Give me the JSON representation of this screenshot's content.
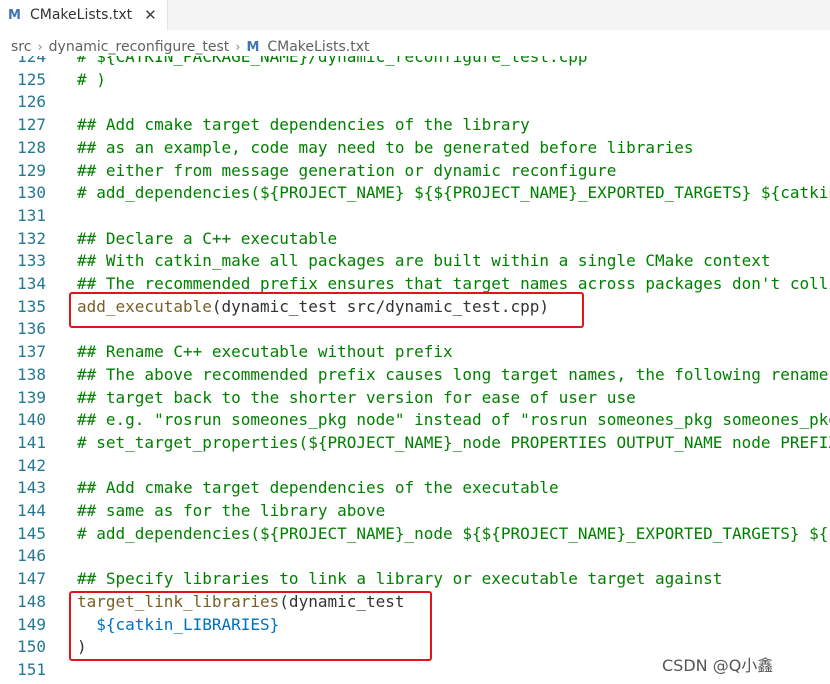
{
  "tab": {
    "icon": "cmake-file-icon",
    "label": "CMakeLists.txt",
    "close": "✕"
  },
  "breadcrumb": {
    "part1": "src",
    "part2": "dynamic_reconfigure_test",
    "file": "CMakeLists.txt"
  },
  "lines": [
    {
      "n": "124",
      "t": "# ${CATKIN_PACKAGE_NAME}/dynamic_reconfigure_test.cpp",
      "k": "cmt"
    },
    {
      "n": "125",
      "t": "# )",
      "k": "cmt"
    },
    {
      "n": "126",
      "t": "",
      "k": "cmt"
    },
    {
      "n": "127",
      "t": "## Add cmake target dependencies of the library",
      "k": "cmt"
    },
    {
      "n": "128",
      "t": "## as an example, code may need to be generated before libraries",
      "k": "cmt"
    },
    {
      "n": "129",
      "t": "## either from message generation or dynamic reconfigure",
      "k": "cmt"
    },
    {
      "n": "130",
      "t": "# add_dependencies(${PROJECT_NAME} ${${PROJECT_NAME}_EXPORTED_TARGETS} ${catkin_EXPORTED_TARGETS})",
      "k": "cmt"
    },
    {
      "n": "131",
      "t": "",
      "k": "cmt"
    },
    {
      "n": "132",
      "t": "## Declare a C++ executable",
      "k": "cmt"
    },
    {
      "n": "133",
      "t": "## With catkin_make all packages are built within a single CMake context",
      "k": "cmt"
    },
    {
      "n": "134",
      "t": "## The recommended prefix ensures that target names across packages don't collide",
      "k": "cmt"
    },
    {
      "n": "135",
      "fn": "add_executable",
      "rest": "(dynamic_test src/dynamic_test.cpp)",
      "k": "call"
    },
    {
      "n": "136",
      "t": "",
      "k": "cmt"
    },
    {
      "n": "137",
      "t": "## Rename C++ executable without prefix",
      "k": "cmt"
    },
    {
      "n": "138",
      "t": "## The above recommended prefix causes long target names, the following renames the",
      "k": "cmt"
    },
    {
      "n": "139",
      "t": "## target back to the shorter version for ease of user use",
      "k": "cmt"
    },
    {
      "n": "140",
      "t": "## e.g. \"rosrun someones_pkg node\" instead of \"rosrun someones_pkg someones_pkg_node\"",
      "k": "cmt"
    },
    {
      "n": "141",
      "t": "# set_target_properties(${PROJECT_NAME}_node PROPERTIES OUTPUT_NAME node PREFIX \"\")",
      "k": "cmt"
    },
    {
      "n": "142",
      "t": "",
      "k": "cmt"
    },
    {
      "n": "143",
      "t": "## Add cmake target dependencies of the executable",
      "k": "cmt"
    },
    {
      "n": "144",
      "t": "## same as for the library above",
      "k": "cmt"
    },
    {
      "n": "145",
      "t": "# add_dependencies(${PROJECT_NAME}_node ${${PROJECT_NAME}_EXPORTED_TARGETS} ${catkin_EXPORTED_TARGETS})",
      "k": "cmt"
    },
    {
      "n": "146",
      "t": "",
      "k": "cmt"
    },
    {
      "n": "147",
      "t": "## Specify libraries to link a library or executable target against",
      "k": "cmt"
    },
    {
      "n": "148",
      "fn": "target_link_libraries",
      "rest": "(dynamic_test",
      "k": "call"
    },
    {
      "n": "149",
      "var": "  ${catkin_LIBRARIES}",
      "k": "var"
    },
    {
      "n": "150",
      "t": ")",
      "k": "plain"
    },
    {
      "n": "151",
      "t": "",
      "k": "cmt"
    }
  ],
  "watermark": "CSDN @Q小鑫",
  "colors": {
    "comment": "#008000",
    "function": "#795e26",
    "highlight": "#e3121b",
    "line_number": "#237893",
    "variable": "#0070c1"
  }
}
